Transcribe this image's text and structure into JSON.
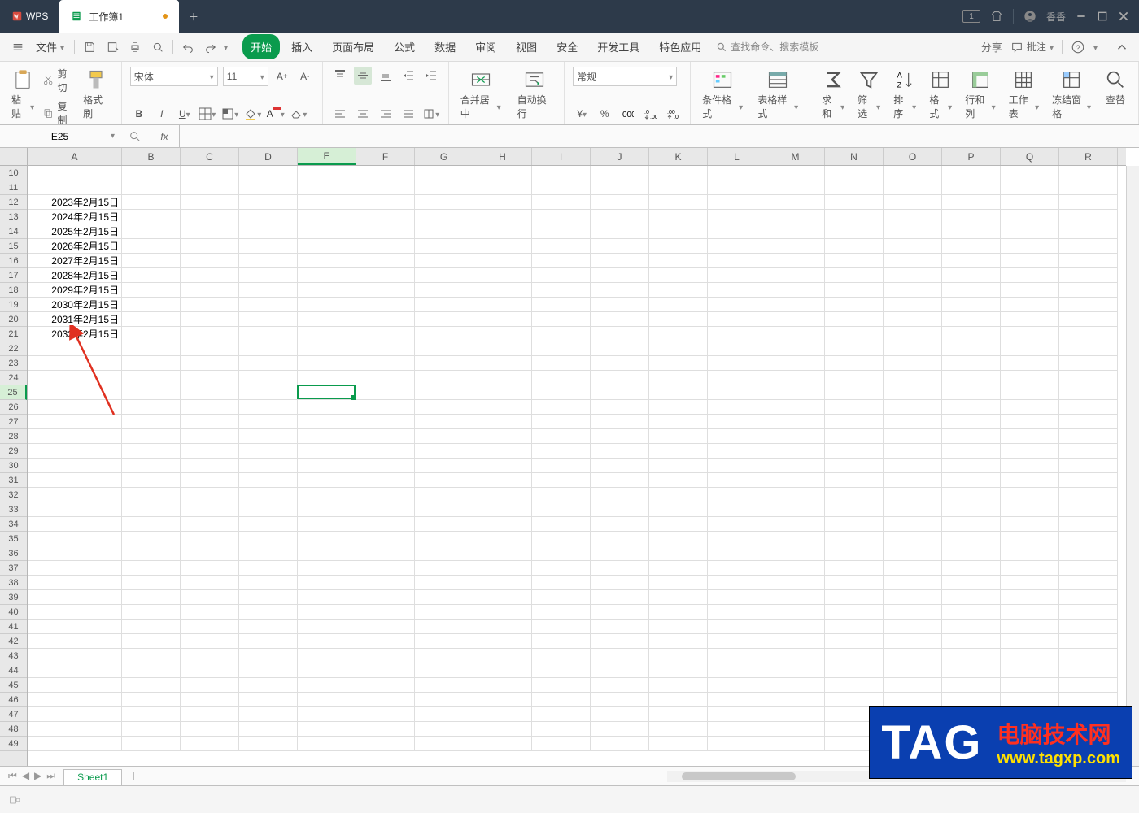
{
  "titlebar": {
    "app": "WPS",
    "active_tab": "工作簿1",
    "user": "香香",
    "badge": "1"
  },
  "menubar": {
    "file": "文件",
    "menus": [
      "开始",
      "插入",
      "页面布局",
      "公式",
      "数据",
      "审阅",
      "视图",
      "安全",
      "开发工具",
      "特色应用"
    ],
    "active": "开始",
    "search_placeholder": "查找命令、搜索模板",
    "share": "分享",
    "comment": "批注"
  },
  "ribbon": {
    "paste": "粘贴",
    "cut": "剪切",
    "copy": "复制",
    "format_painter": "格式刷",
    "font_name": "宋体",
    "font_size": "11",
    "merge": "合并居中",
    "wrap": "自动换行",
    "number_format": "常规",
    "cond_format": "条件格式",
    "table_style": "表格样式",
    "sum": "求和",
    "filter": "筛选",
    "sort": "排序",
    "format": "格式",
    "rowcol": "行和列",
    "worksheet": "工作表",
    "freeze": "冻结窗格",
    "findrep": "查替"
  },
  "namebox": "E25",
  "formula": "",
  "grid": {
    "columns": [
      "A",
      "B",
      "C",
      "D",
      "E",
      "F",
      "G",
      "H",
      "I",
      "J",
      "K",
      "L",
      "M",
      "N",
      "O",
      "P",
      "Q",
      "R"
    ],
    "first_row": 10,
    "row_count": 40,
    "active_col": "E",
    "active_row": 25,
    "data": {
      "12": "2023年2月15日",
      "13": "2024年2月15日",
      "14": "2025年2月15日",
      "15": "2026年2月15日",
      "16": "2027年2月15日",
      "17": "2028年2月15日",
      "18": "2029年2月15日",
      "19": "2030年2月15日",
      "20": "2031年2月15日",
      "21": "2032年2月15日"
    }
  },
  "sheets": {
    "active": "Sheet1"
  },
  "watermark": {
    "tag": "TAG",
    "line1": "电脑技术网",
    "line2": "www.tagxp.com"
  }
}
